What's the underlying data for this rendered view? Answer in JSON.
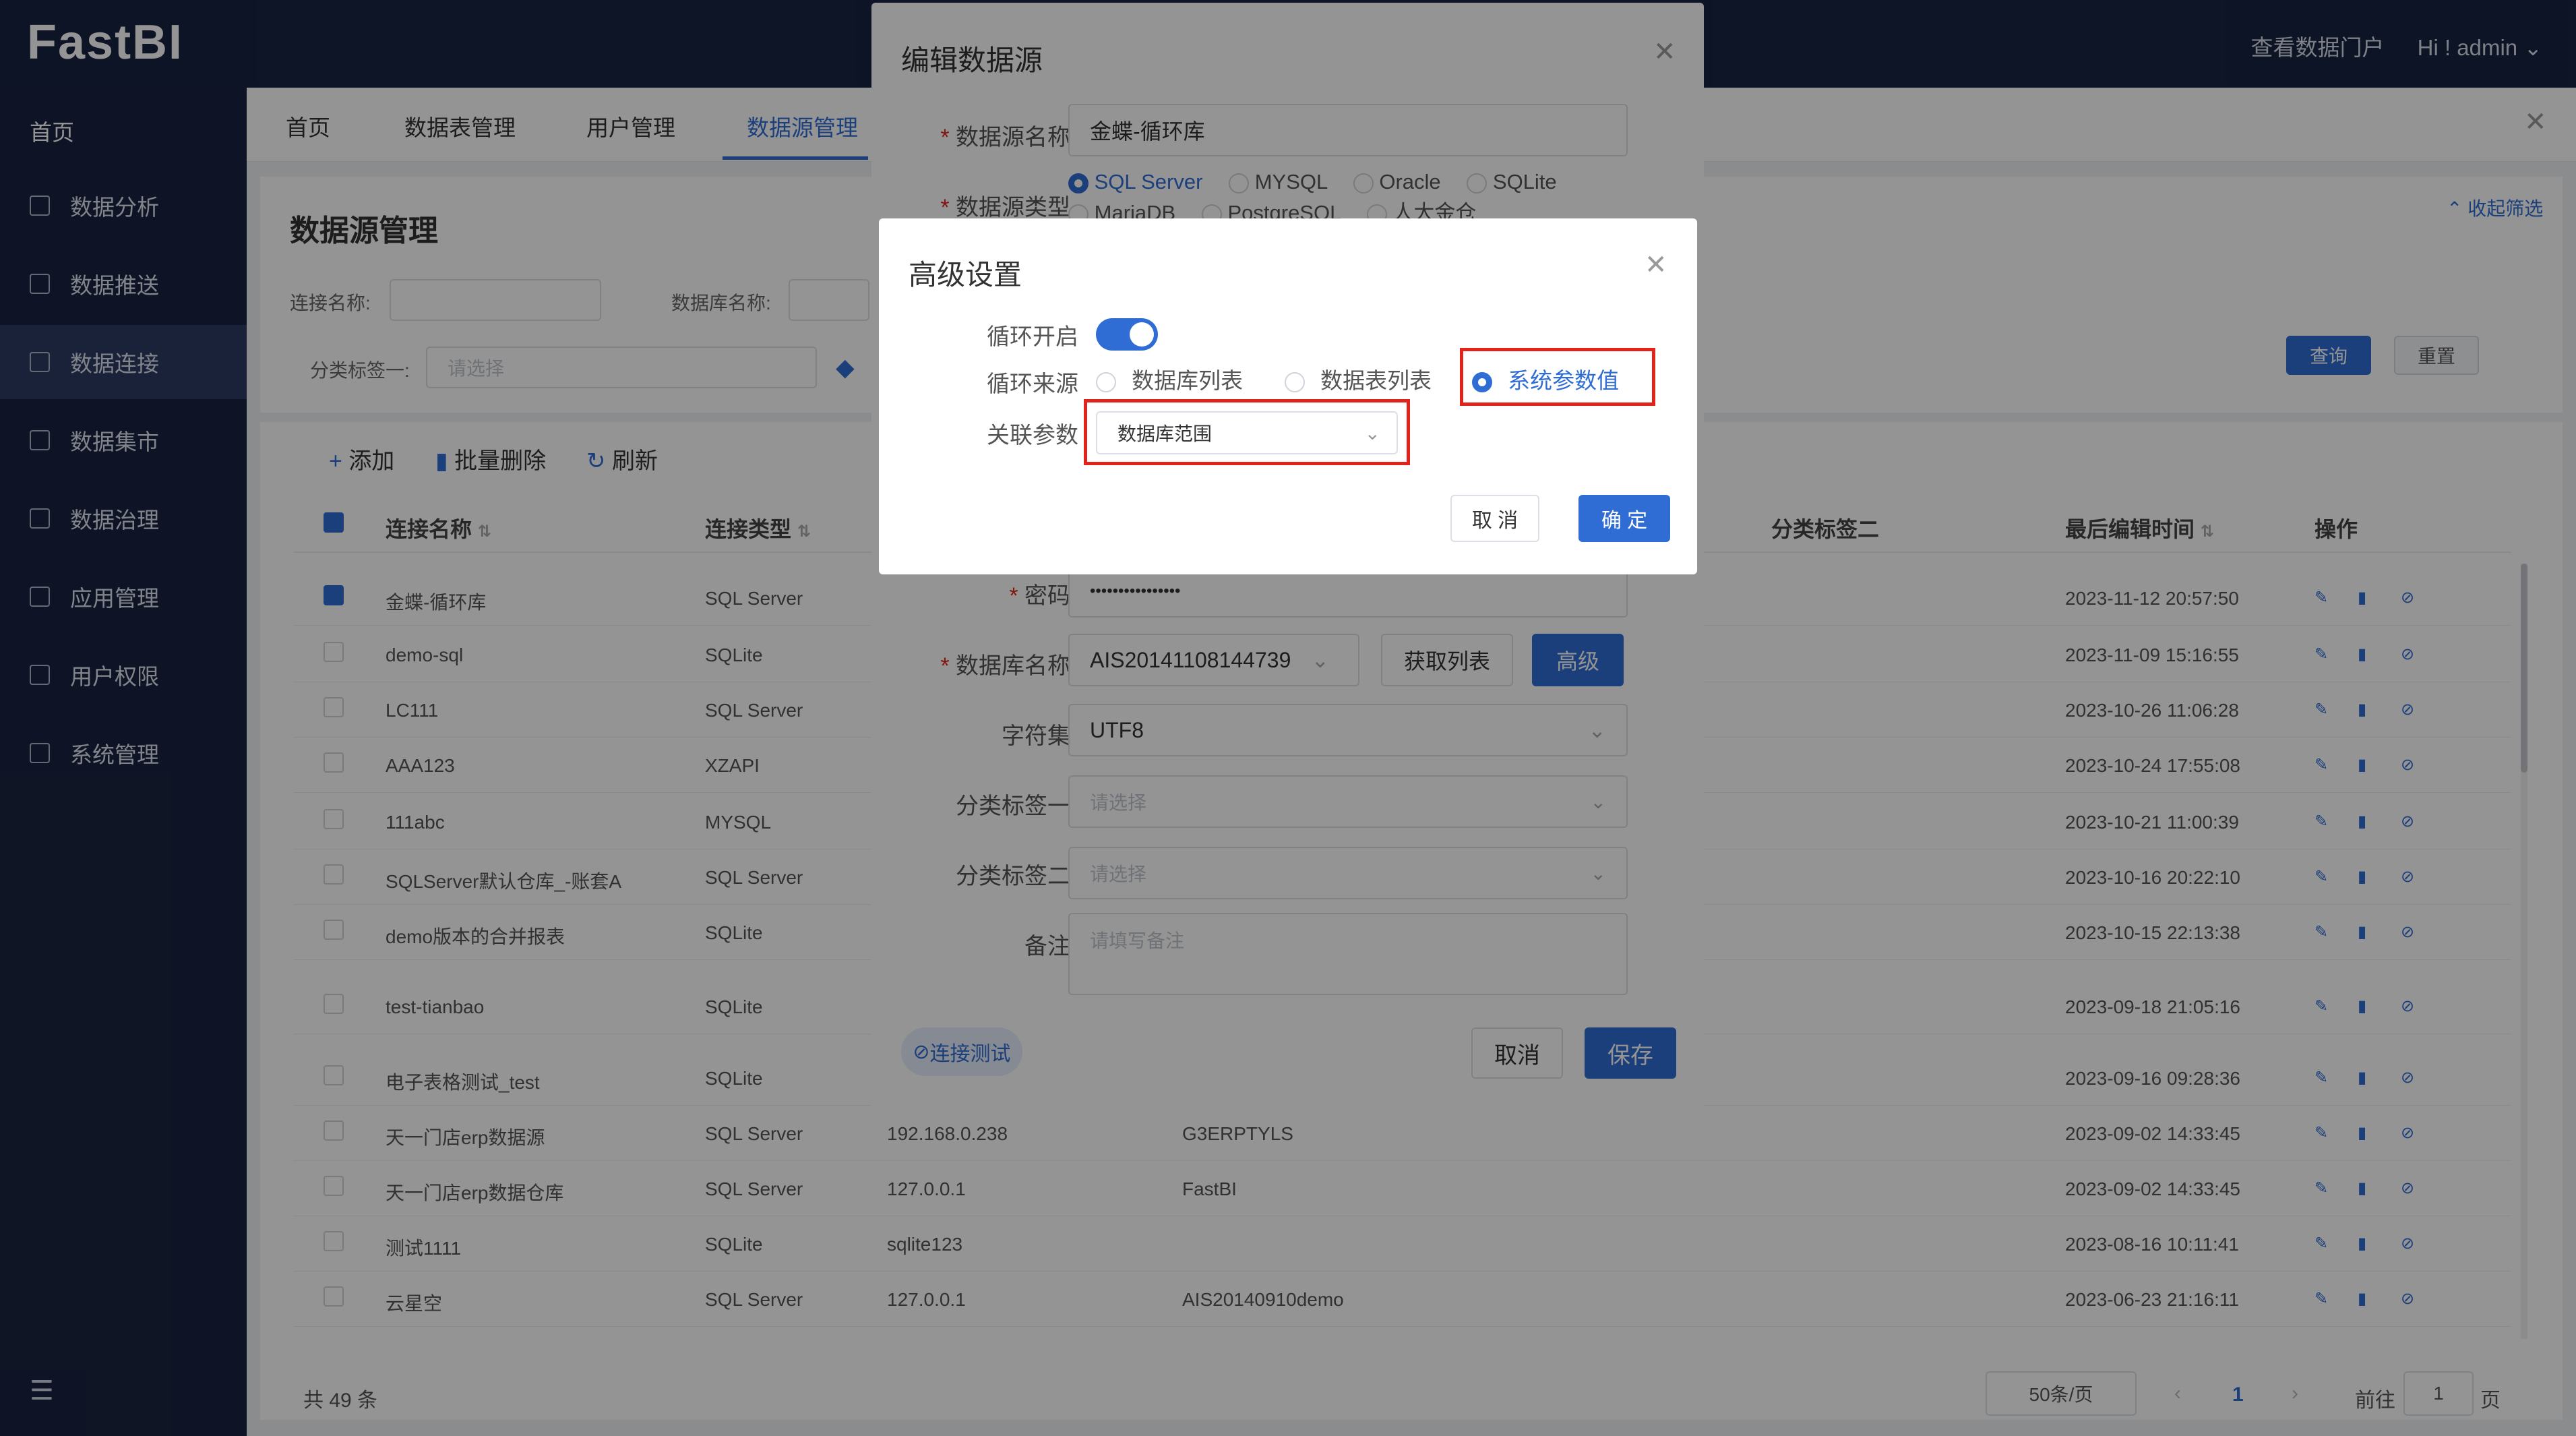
{
  "header": {
    "logo": "FastBI",
    "view_portal": "查看数据门户",
    "user": "Hi ! admin"
  },
  "sidebar": {
    "home": "首页",
    "items": [
      {
        "label": "数据分析"
      },
      {
        "label": "数据推送"
      },
      {
        "label": "数据连接"
      },
      {
        "label": "数据集市"
      },
      {
        "label": "数据治理"
      },
      {
        "label": "应用管理"
      },
      {
        "label": "用户权限"
      },
      {
        "label": "系统管理"
      }
    ]
  },
  "tabs": [
    "首页",
    "数据表管理",
    "用户管理",
    "数据源管理"
  ],
  "page": {
    "title": "数据源管理",
    "collapse": "收起筛选",
    "filters": {
      "conn_name": "连接名称:",
      "db_name": "数据库名称:",
      "tag1": "分类标签一:",
      "tag1_placeholder": "请选择"
    },
    "query": "查询",
    "reset": "重置",
    "toolbar": {
      "add": "添加",
      "batch_delete": "批量删除",
      "refresh": "刷新"
    },
    "columns": {
      "name": "连接名称",
      "type": "连接类型",
      "tag2": "分类标签二",
      "edited": "最后编辑时间",
      "ops": "操作"
    },
    "rows": [
      {
        "name": "金蝶-循环库",
        "type": "SQL Server",
        "host": "",
        "db": "",
        "time": "2023-11-12 20:57:50",
        "checked": true
      },
      {
        "name": "demo-sql",
        "type": "SQLite",
        "host": "",
        "db": "",
        "time": "2023-11-09 15:16:55"
      },
      {
        "name": "LC111",
        "type": "SQL Server",
        "host": "",
        "db": "",
        "time": "2023-10-26 11:06:28"
      },
      {
        "name": "AAA123",
        "type": "XZAPI",
        "host": "",
        "db": "",
        "time": "2023-10-24 17:55:08"
      },
      {
        "name": "111abc",
        "type": "MYSQL",
        "host": "",
        "db": "",
        "time": "2023-10-21 11:00:39"
      },
      {
        "name": "SQLServer默认仓库_-账套A",
        "type": "SQL Server",
        "host": "",
        "db": "",
        "time": "2023-10-16 20:22:10"
      },
      {
        "name": "demo版本的合并报表",
        "type": "SQLite",
        "host": "",
        "db": "",
        "time": "2023-10-15 22:13:38"
      },
      {
        "name": "test-tianbao",
        "type": "SQLite",
        "host": "",
        "db": "",
        "time": "2023-09-18 21:05:16"
      },
      {
        "name": "电子表格测试_test",
        "type": "SQLite",
        "host": "",
        "db": "",
        "time": "2023-09-16 09:28:36"
      },
      {
        "name": "天一门店erp数据源",
        "type": "SQL Server",
        "host": "192.168.0.238",
        "db": "G3ERPTYLS",
        "time": "2023-09-02 14:33:45"
      },
      {
        "name": "天一门店erp数据仓库",
        "type": "SQL Server",
        "host": "127.0.0.1",
        "db": "FastBI",
        "time": "2023-09-02 14:33:45"
      },
      {
        "name": "测试1111",
        "type": "SQLite",
        "host": "sqlite123",
        "db": "",
        "time": "2023-08-16 10:11:41"
      },
      {
        "name": "云星空",
        "type": "SQL Server",
        "host": "127.0.0.1",
        "db": "AIS20140910demo",
        "time": "2023-06-23 21:16:11"
      }
    ],
    "pagination": {
      "total": "共 49 条",
      "page_size": "50条/页",
      "current": "1",
      "goto": "前往",
      "page_input": "1",
      "page_unit": "页"
    }
  },
  "edit_dialog": {
    "title": "编辑数据源",
    "name_label": "数据源名称",
    "name_value": "金蝶-循环库",
    "type_label": "数据源类型",
    "types": [
      "SQL Server",
      "MYSQL",
      "Oracle",
      "SQLite",
      "MariaDB",
      "PostgreSQL",
      "人大金仓"
    ],
    "password_label": "密码",
    "password_value": "••••••••••••••••",
    "dbname_label": "数据库名称",
    "dbname_value": "AIS20141108144739",
    "fetch_list": "获取列表",
    "advanced": "高级",
    "charset_label": "字符集",
    "charset_value": "UTF8",
    "tag1_label": "分类标签一",
    "tag2_label": "分类标签二",
    "select_placeholder": "请选择",
    "remark_label": "备注",
    "remark_placeholder": "请填写备注",
    "test_conn": "连接测试",
    "cancel": "取消",
    "save": "保存"
  },
  "adv_dialog": {
    "title": "高级设置",
    "loop_label": "循环开启",
    "loop_on": true,
    "source_label": "循环来源",
    "sources": [
      "数据库列表",
      "数据表列表",
      "系统参数值"
    ],
    "selected_source": "系统参数值",
    "param_label": "关联参数",
    "param_value": "数据库范围",
    "cancel": "取 消",
    "ok": "确 定"
  },
  "colors": {
    "primary": "#2f6dd5",
    "dark": "#182441",
    "highlight": "#e0241b"
  }
}
